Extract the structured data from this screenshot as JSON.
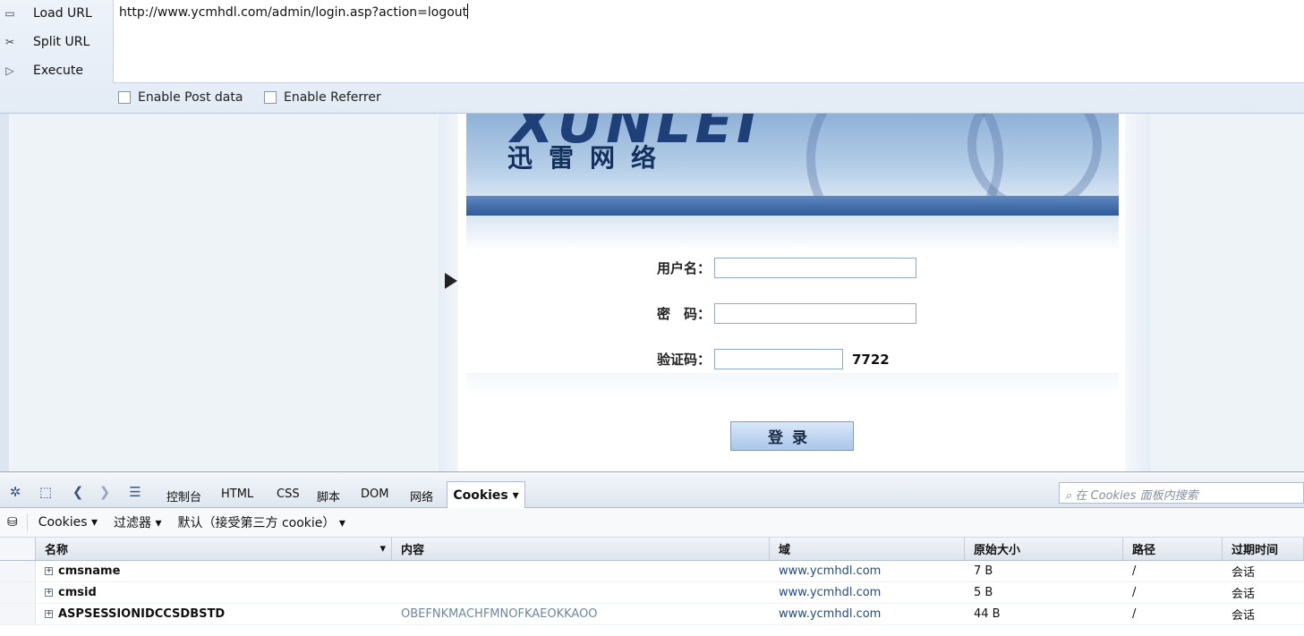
{
  "hackbar": {
    "load_url": "Load URL",
    "split_url": "Split URL",
    "execute": "Execute",
    "url": "http://www.ycmhdl.com/admin/login.asp?action=logout",
    "enable_post": "Enable Post data",
    "enable_referrer": "Enable Referrer"
  },
  "page": {
    "logo_text": "XUNLEI",
    "logo_cn": "迅雷网络",
    "username_label": "用户名：",
    "password_label": "密　码：",
    "captcha_label": "验证码：",
    "captcha_value": "7722",
    "login_button": "登录"
  },
  "firebug": {
    "tabs": [
      "控制台",
      "HTML",
      "CSS",
      "脚本",
      "DOM",
      "网络"
    ],
    "active_tab": "Cookies ▾",
    "search_placeholder": "在 Cookies 面板内搜索",
    "sub_toolbar": {
      "cookies": "Cookies ▾",
      "filter": "过滤器 ▾",
      "default": "默认（接受第三方 cookie） ▾"
    },
    "columns": [
      "名称",
      "内容",
      "域",
      "原始大小",
      "路径",
      "过期时间"
    ],
    "rows": [
      {
        "name": "cmsname",
        "content": "",
        "domain": "www.ycmhdl.com",
        "size": "7 B",
        "path": "/",
        "expires": "会话"
      },
      {
        "name": "cmsid",
        "content": "",
        "domain": "www.ycmhdl.com",
        "size": "5 B",
        "path": "/",
        "expires": "会话"
      },
      {
        "name": "ASPSESSIONIDCCSDBSTD",
        "content": "OBEFNKMACHFMNOFKAEOKKAOO",
        "domain": "www.ycmhdl.com",
        "size": "44 B",
        "path": "/",
        "expires": "会话"
      }
    ]
  },
  "colors": {
    "banner_blue": "#2c5696",
    "link_blue": "#1f4a8f",
    "cookie_content": "#6f86a4"
  }
}
